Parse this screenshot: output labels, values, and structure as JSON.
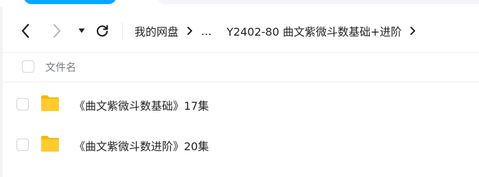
{
  "toolbar": {
    "back_icon": "chevron-left-icon",
    "forward_icon": "chevron-right-icon",
    "dropdown_icon": "caret-down-icon",
    "refresh_icon": "refresh-icon"
  },
  "breadcrumb": {
    "root": "我的网盘",
    "ellipsis": "...",
    "current": "Y2402-80 曲文紫微斗数基础+进阶"
  },
  "list": {
    "header": {
      "name_col": "文件名"
    },
    "items": [
      {
        "name": "《曲文紫微斗数基础》17集",
        "type": "folder"
      },
      {
        "name": "《曲文紫微斗数进阶》20集",
        "type": "folder"
      }
    ]
  },
  "colors": {
    "accent": "#06a7ff",
    "folder": "#ffcb2f"
  }
}
